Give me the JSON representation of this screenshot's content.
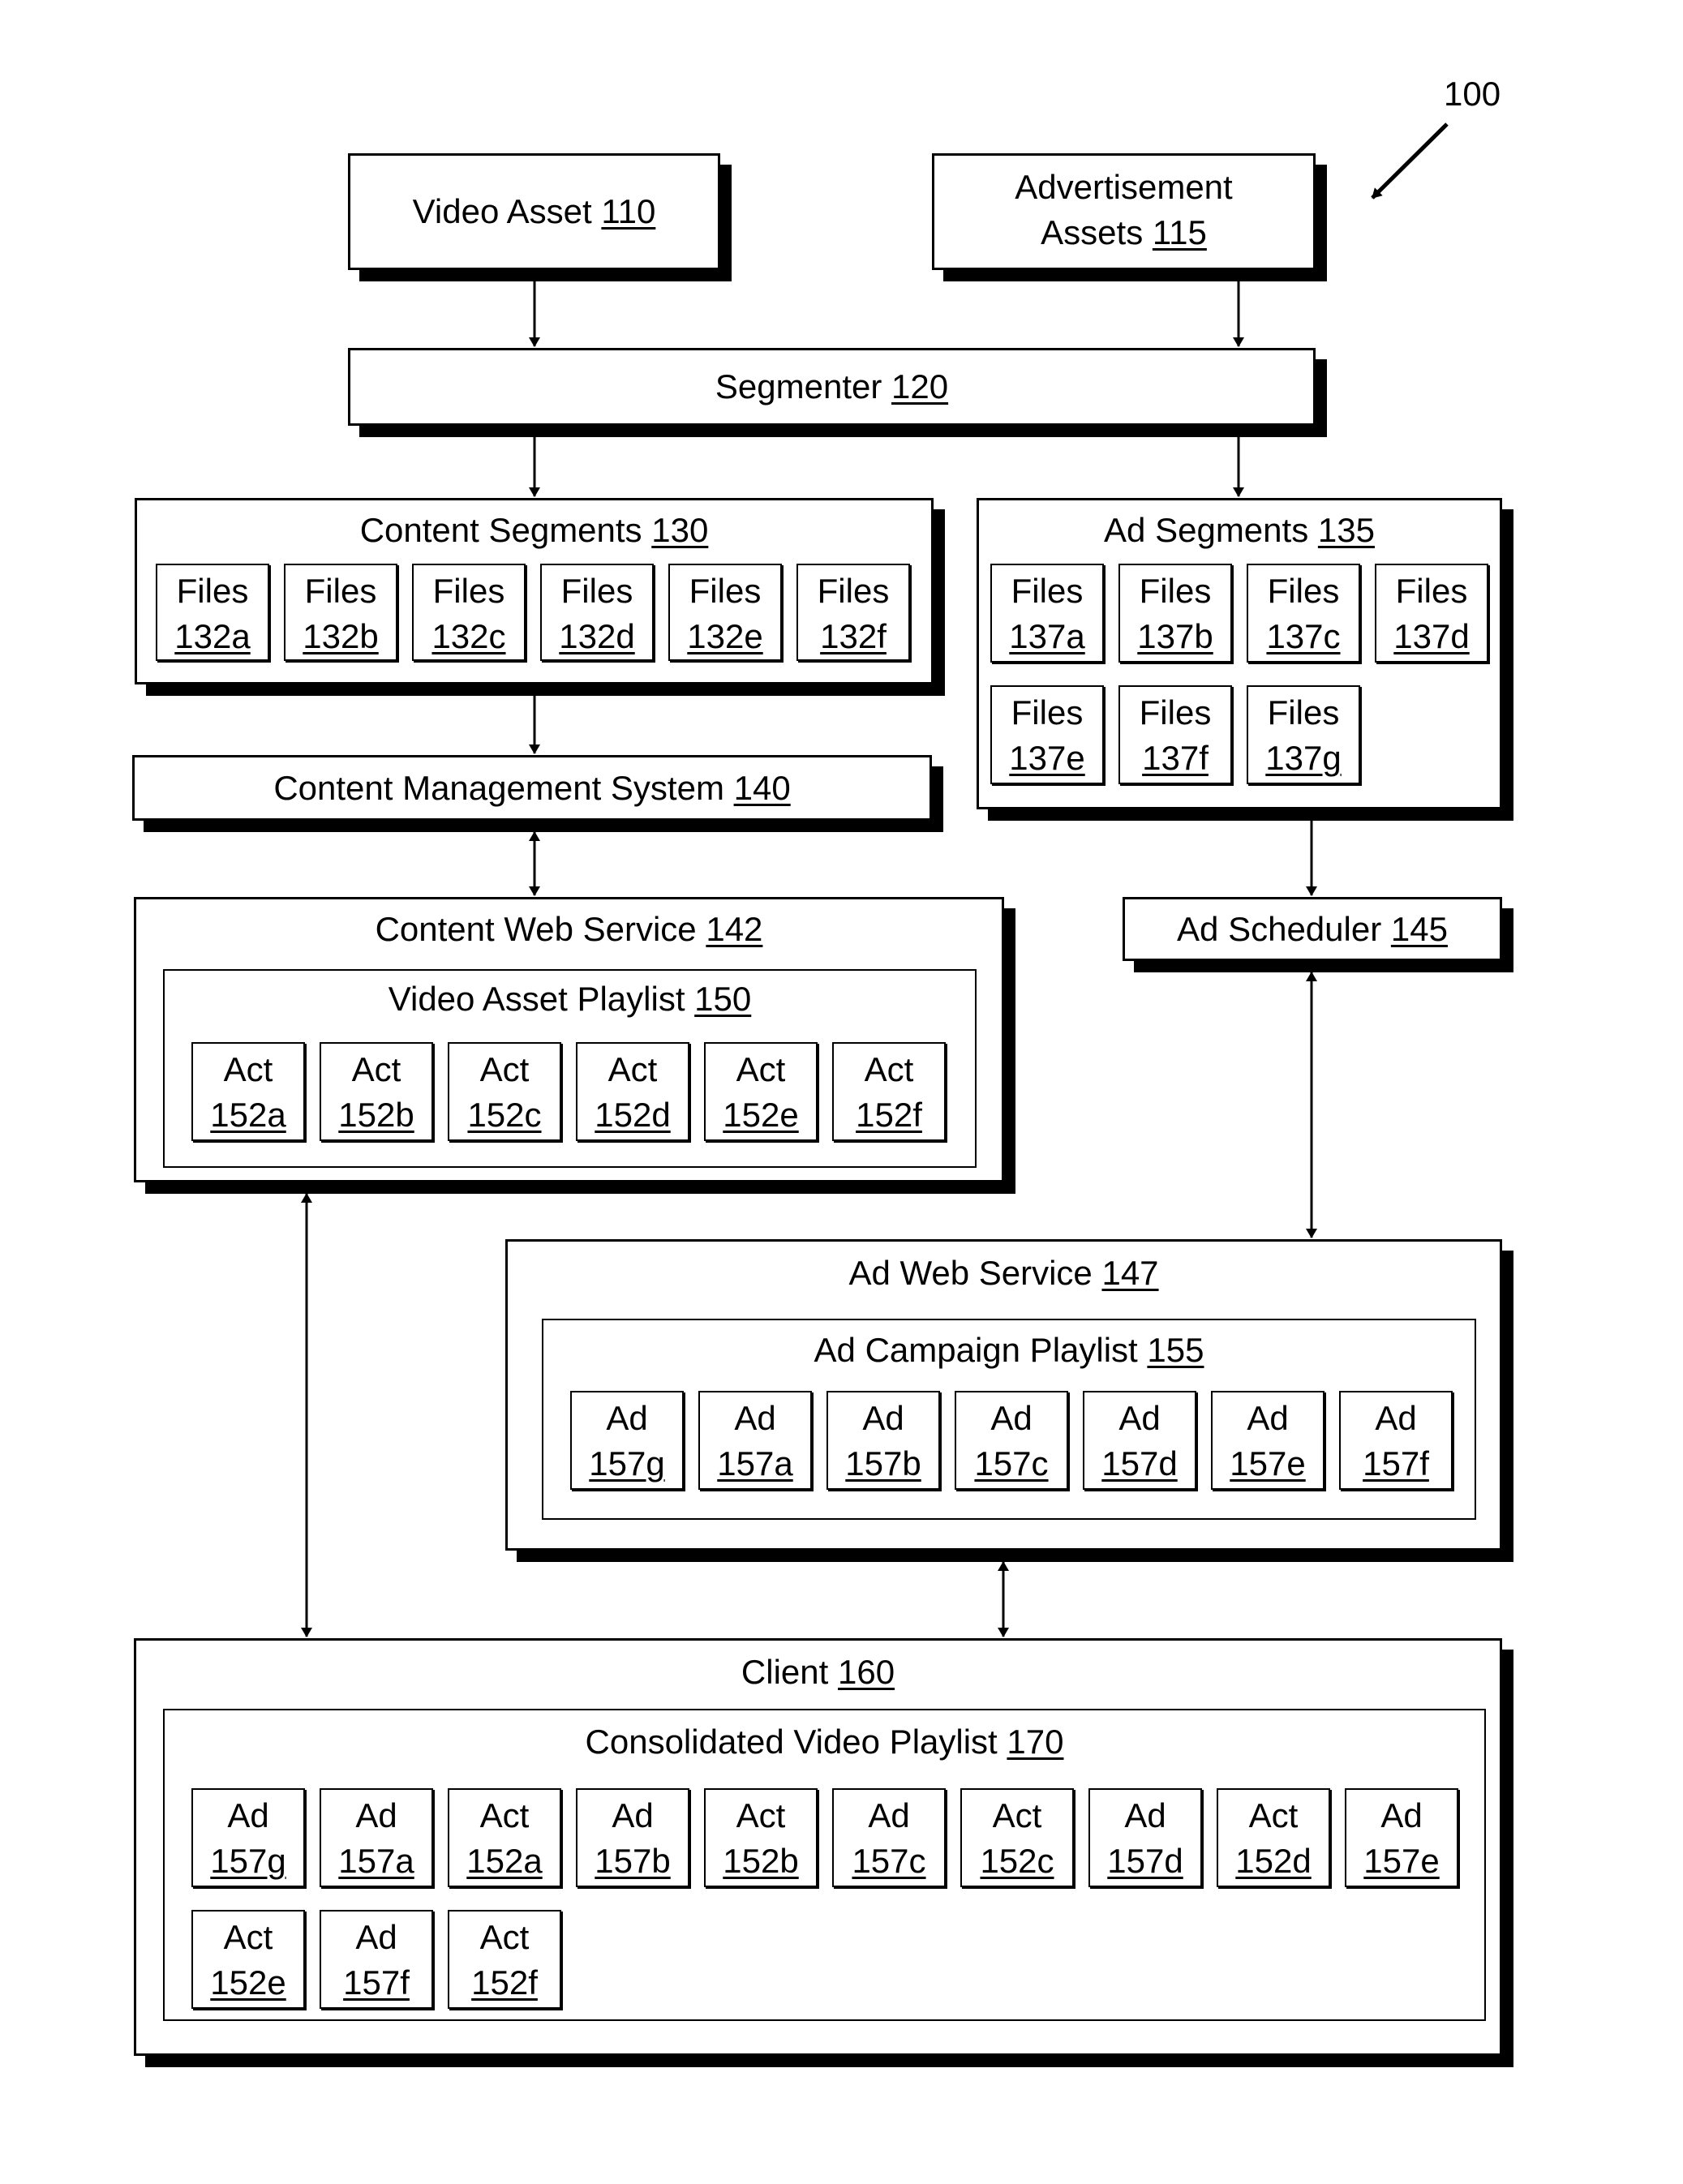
{
  "figure_label": "100",
  "nodes": {
    "video_asset": {
      "label": "Video Asset",
      "ref": "110"
    },
    "ad_assets": {
      "label_line1": "Advertisement",
      "label_line2": "Assets",
      "ref": "115"
    },
    "segmenter": {
      "label": "Segmenter",
      "ref": "120"
    },
    "content_segments": {
      "label": "Content Segments",
      "ref": "130",
      "items": [
        {
          "label": "Files",
          "ref": "132a"
        },
        {
          "label": "Files",
          "ref": "132b"
        },
        {
          "label": "Files",
          "ref": "132c"
        },
        {
          "label": "Files",
          "ref": "132d"
        },
        {
          "label": "Files",
          "ref": "132e"
        },
        {
          "label": "Files",
          "ref": "132f"
        }
      ]
    },
    "ad_segments": {
      "label": "Ad Segments",
      "ref": "135",
      "items": [
        {
          "label": "Files",
          "ref": "137a"
        },
        {
          "label": "Files",
          "ref": "137b"
        },
        {
          "label": "Files",
          "ref": "137c"
        },
        {
          "label": "Files",
          "ref": "137d"
        },
        {
          "label": "Files",
          "ref": "137e"
        },
        {
          "label": "Files",
          "ref": "137f"
        },
        {
          "label": "Files",
          "ref": "137g"
        }
      ]
    },
    "cms": {
      "label": "Content Management System",
      "ref": "140"
    },
    "content_web_service": {
      "label": "Content Web Service",
      "ref": "142",
      "playlist": {
        "label": "Video Asset Playlist",
        "ref": "150",
        "items": [
          {
            "label": "Act",
            "ref": "152a"
          },
          {
            "label": "Act",
            "ref": "152b"
          },
          {
            "label": "Act",
            "ref": "152c"
          },
          {
            "label": "Act",
            "ref": "152d"
          },
          {
            "label": "Act",
            "ref": "152e"
          },
          {
            "label": "Act",
            "ref": "152f"
          }
        ]
      }
    },
    "ad_scheduler": {
      "label": "Ad Scheduler",
      "ref": "145"
    },
    "ad_web_service": {
      "label": "Ad Web Service",
      "ref": "147",
      "playlist": {
        "label": "Ad Campaign Playlist",
        "ref": "155",
        "items": [
          {
            "label": "Ad",
            "ref": "157g"
          },
          {
            "label": "Ad",
            "ref": "157a"
          },
          {
            "label": "Ad",
            "ref": "157b"
          },
          {
            "label": "Ad",
            "ref": "157c"
          },
          {
            "label": "Ad",
            "ref": "157d"
          },
          {
            "label": "Ad",
            "ref": "157e"
          },
          {
            "label": "Ad",
            "ref": "157f"
          }
        ]
      }
    },
    "client": {
      "label": "Client",
      "ref": "160",
      "playlist": {
        "label": "Consolidated Video Playlist",
        "ref": "170",
        "items": [
          {
            "label": "Ad",
            "ref": "157g"
          },
          {
            "label": "Ad",
            "ref": "157a"
          },
          {
            "label": "Act",
            "ref": "152a"
          },
          {
            "label": "Ad",
            "ref": "157b"
          },
          {
            "label": "Act",
            "ref": "152b"
          },
          {
            "label": "Ad",
            "ref": "157c"
          },
          {
            "label": "Act",
            "ref": "152c"
          },
          {
            "label": "Ad",
            "ref": "157d"
          },
          {
            "label": "Act",
            "ref": "152d"
          },
          {
            "label": "Ad",
            "ref": "157e"
          },
          {
            "label": "Act",
            "ref": "152e"
          },
          {
            "label": "Ad",
            "ref": "157f"
          },
          {
            "label": "Act",
            "ref": "152f"
          }
        ]
      }
    }
  },
  "edges": [
    {
      "from": "Video Asset 110",
      "to": "Segmenter 120",
      "direction": "one-way"
    },
    {
      "from": "Advertisement Assets 115",
      "to": "Segmenter 120",
      "direction": "one-way"
    },
    {
      "from": "Segmenter 120",
      "to": "Content Segments 130",
      "direction": "one-way"
    },
    {
      "from": "Segmenter 120",
      "to": "Ad Segments 135",
      "direction": "one-way"
    },
    {
      "from": "Content Segments 130",
      "to": "Content Management System 140",
      "direction": "one-way"
    },
    {
      "from": "Content Management System 140",
      "to": "Content Web Service 142",
      "direction": "two-way"
    },
    {
      "from": "Ad Segments 135",
      "to": "Ad Scheduler 145",
      "direction": "one-way"
    },
    {
      "from": "Ad Scheduler 145",
      "to": "Ad Web Service 147",
      "direction": "two-way"
    },
    {
      "from": "Content Web Service 142",
      "to": "Client 160",
      "direction": "two-way"
    },
    {
      "from": "Ad Web Service 147",
      "to": "Client 160",
      "direction": "two-way"
    }
  ]
}
